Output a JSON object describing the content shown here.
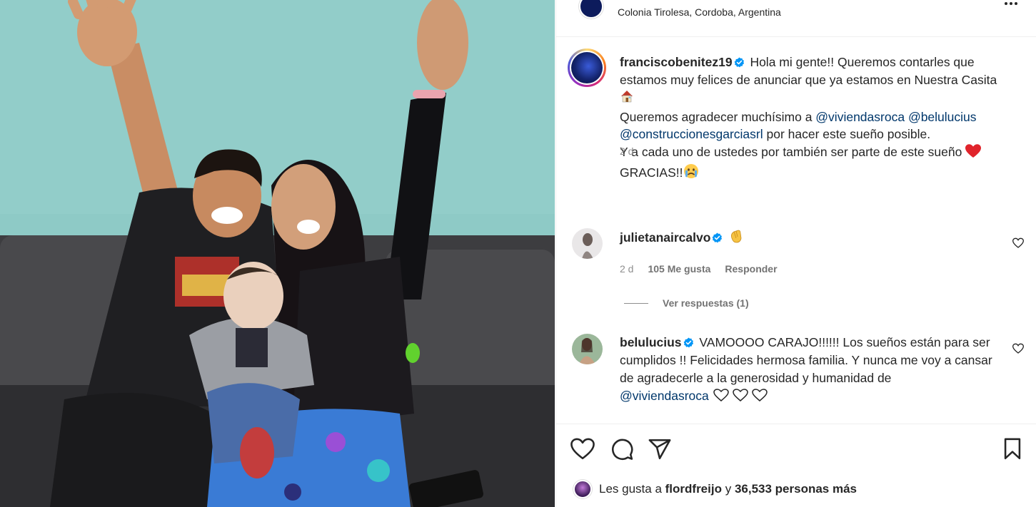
{
  "post": {
    "location": "Colonia Tirolesa, Cordoba, Argentina",
    "author": "franciscobenitez19",
    "caption_line1": "Hola mi gente!! Queremos contarles que estamos muy felices de anunciar que ya estamos en Nuestra Casita",
    "caption_line2": "Queremos agradecer muchísimo a",
    "mention1": "@viviendasroca",
    "mention2": "@belulucius",
    "mention3": "@construccionesgarciasrl",
    "caption_line3": "por hacer este sueño posible.",
    "caption_line4": "Y a cada uno de ustedes por también ser parte de este sueño",
    "caption_line5": "GRACIAS!!",
    "time": "2 d"
  },
  "comments": [
    {
      "username": "julietanaircalvo",
      "text": "",
      "time": "2 d",
      "likes": "105 Me gusta",
      "reply": "Responder",
      "view_replies": "Ver respuestas (1)"
    },
    {
      "username": "belulucius",
      "text": "VAMOOOO CARAJO!!!!!! Los sueños están para ser cumplidos !! Felicidades hermosa familia. Y nunca me voy a cansar de agradecerle a la generosidad y humanidad de",
      "mention": "@viviendasroca"
    }
  ],
  "likes": {
    "prefix": "Les gusta a",
    "user": "flordfreijo",
    "middle": "y",
    "count": "36,533 personas más"
  },
  "icons": {
    "more": "more-horizontal-icon",
    "like": "heart-icon",
    "comment": "comment-icon",
    "share": "send-icon",
    "save": "bookmark-icon",
    "verified": "verified-badge-icon"
  },
  "colors": {
    "verified": "#0095f6",
    "mention": "#00376b",
    "muted": "#8e8e8e"
  }
}
